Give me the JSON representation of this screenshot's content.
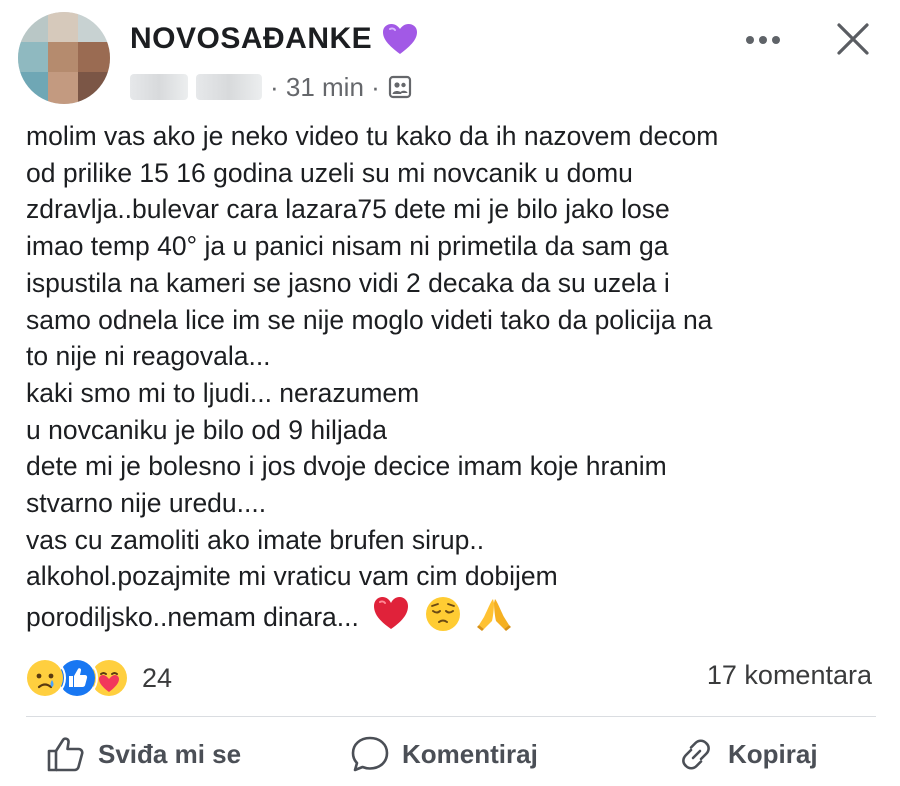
{
  "header": {
    "group_name": "NOVOSAĐANKE",
    "name_emoji": "purple-heart",
    "time": "· 31 min ·",
    "privacy_icon": "group-members-icon",
    "menu_icon": "more-dots-icon",
    "close_icon": "close-icon"
  },
  "post": {
    "lines": [
      "molim vas ako je neko video tu kako da ih nazovem decom",
      "od prilike 15 16 godina uzeli su mi novcanik u domu",
      "zdravlja..bulevar cara lazara75 dete mi je bilo jako lose",
      "imao temp 40° ja u panici nisam ni primetila da sam ga",
      "ispustila na kameri se jasno vidi 2 decaka da su uzela i",
      "samo odnela lice im se nije moglo videti tako da policija na",
      "to nije ni reagovala...",
      "kaki smo mi to ljudi... nerazumem",
      "u novcaniku je bilo od 9 hiljada",
      "dete mi je bolesno i jos dvoje decice imam koje hranim",
      "stvarno nije uredu....",
      "vas cu zamoliti ako imate brufen sirup..",
      "alkohol.pozajmite mi vraticu vam cim dobijem"
    ],
    "last_line": "porodiljsko..nemam dinara...",
    "trailing_emojis": [
      "red-heart",
      "pensive-face",
      "folded-hands"
    ]
  },
  "stats": {
    "reaction_icons": [
      "sad",
      "like",
      "care"
    ],
    "reaction_count": "24",
    "comments": "17 komentara"
  },
  "actions": {
    "like": "Sviđa mi se",
    "comment": "Komentiraj",
    "copy": "Kopiraj"
  },
  "colors": {
    "text": "#1c1e21",
    "meta": "#65676b",
    "like_blue": "#1877f2",
    "heart_red": "#e0223a",
    "purple": "#a259e6"
  }
}
